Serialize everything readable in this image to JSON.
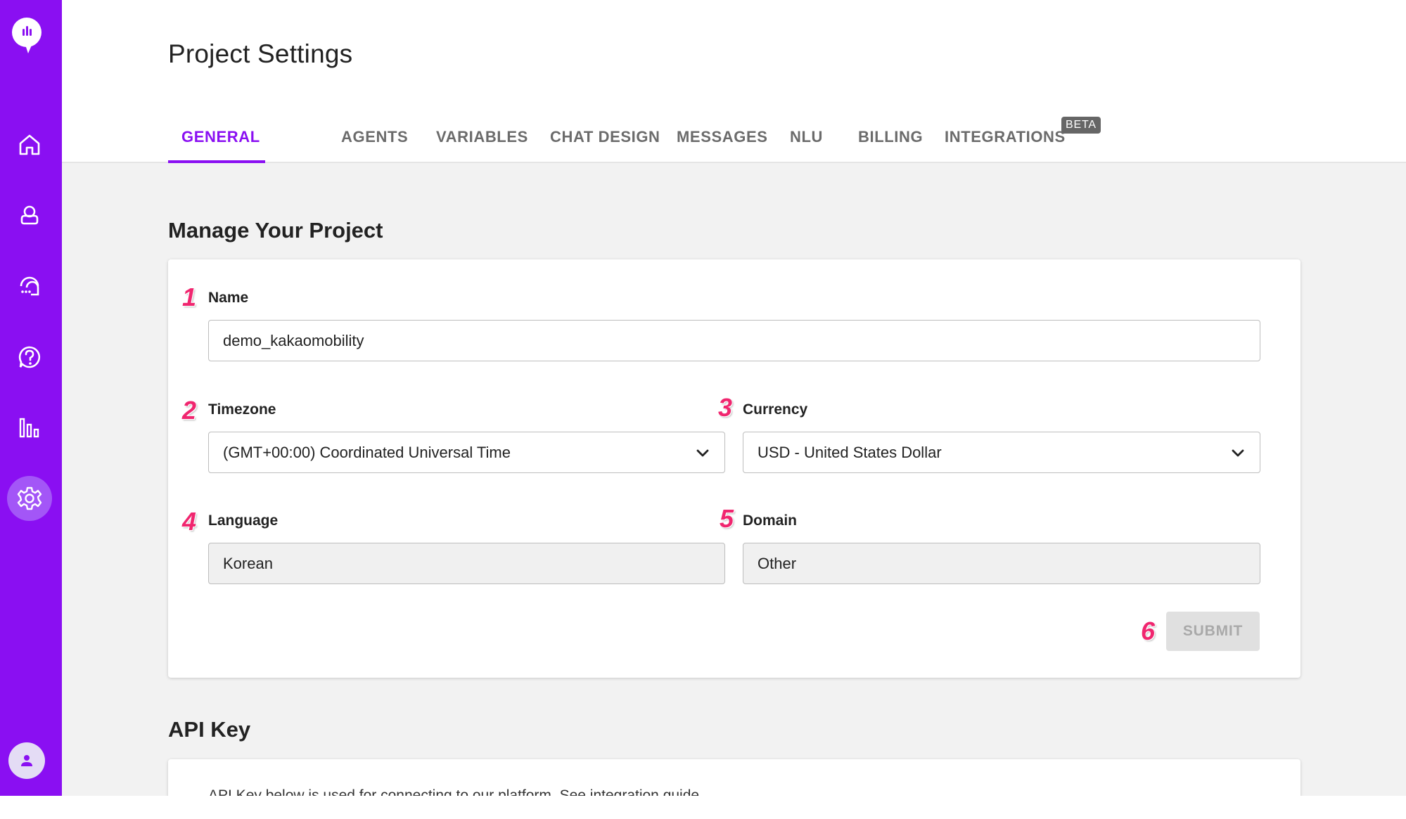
{
  "header": {
    "title": "Project Settings"
  },
  "tabs": [
    {
      "label": "GENERAL"
    },
    {
      "label": "AGENTS"
    },
    {
      "label": "VARIABLES"
    },
    {
      "label": "CHAT DESIGN"
    },
    {
      "label": "MESSAGES"
    },
    {
      "label": "NLU"
    },
    {
      "label": "BILLING"
    },
    {
      "label": "INTEGRATIONS",
      "badge": "BETA"
    }
  ],
  "manage": {
    "title": "Manage Your Project",
    "fields": {
      "name": {
        "number": "1",
        "label": "Name",
        "value": "demo_kakaomobility"
      },
      "timezone": {
        "number": "2",
        "label": "Timezone",
        "value": "(GMT+00:00) Coordinated Universal Time"
      },
      "currency": {
        "number": "3",
        "label": "Currency",
        "value": "USD - United States Dollar"
      },
      "language": {
        "number": "4",
        "label": "Language",
        "value": "Korean"
      },
      "domain": {
        "number": "5",
        "label": "Domain",
        "value": "Other"
      }
    },
    "submit": {
      "number": "6",
      "label": "SUBMIT"
    }
  },
  "api": {
    "title": "API Key",
    "description": "API Key below is used for connecting to our platform. See integration guide"
  },
  "colors": {
    "brand": "#8a0ff2",
    "accent_number": "#f0266f"
  },
  "sidebar": {
    "icons": [
      "logo-icon",
      "home-icon",
      "user-icon",
      "chat-agent-icon",
      "help-icon",
      "chart-icon",
      "settings-icon"
    ]
  }
}
